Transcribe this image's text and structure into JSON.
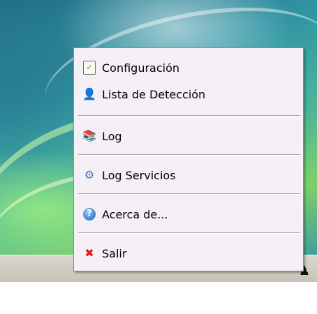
{
  "menu": {
    "items": [
      {
        "label": "Configuración",
        "icon": "settings-document-icon"
      },
      {
        "label": "Lista de Detección",
        "icon": "person-icon"
      },
      {
        "label": "Log",
        "icon": "books-icon"
      },
      {
        "label": "Log Servicios",
        "icon": "services-gears-icon"
      },
      {
        "label": "Acerca de...",
        "icon": "help-icon"
      },
      {
        "label": "Salir",
        "icon": "exit-x-icon"
      }
    ]
  },
  "colors": {
    "menu_background": "#f4f0f6",
    "exit_icon": "#d8201f",
    "help_icon": "#1d5fb8"
  }
}
